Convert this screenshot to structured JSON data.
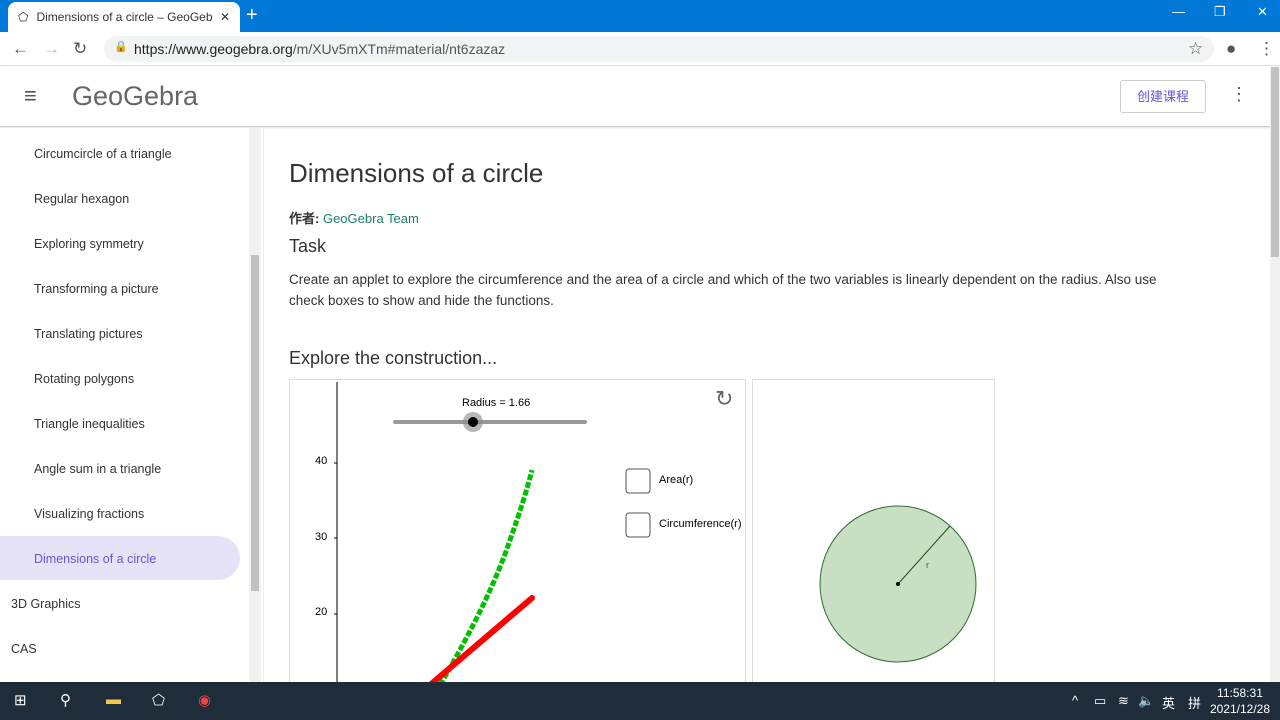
{
  "browser": {
    "tab_title": "Dimensions of a circle – GeoGebra",
    "url_domain": "https://www.geogebra.org",
    "url_path": "/m/XUv5mXTm#material/nt6zazaz"
  },
  "header": {
    "logo": "GeoGebra",
    "create_button": "创建课程"
  },
  "sidebar": {
    "items": [
      "Circumcircle of a triangle",
      "Regular hexagon",
      "Exploring symmetry",
      "Transforming a picture",
      "Translating pictures",
      "Rotating polygons",
      "Triangle inequalities",
      "Angle sum in a triangle",
      "Visualizing fractions",
      "Dimensions of a circle"
    ],
    "sections": [
      "3D Graphics",
      "CAS"
    ]
  },
  "main": {
    "title": "Dimensions of a circle",
    "author_label": "作者:",
    "author": "GeoGebra Team",
    "task_heading": "Task",
    "task_text": "Create an applet to explore the circumference and the area of a circle and which of the two variables is linearly dependent on the radius. Also use check boxes to show and hide the functions.",
    "explore_heading": "Explore the construction..."
  },
  "applet": {
    "slider_label": "Radius = 1.66",
    "radius": 1.66,
    "slider_min": 0,
    "slider_max": 3.5,
    "y_ticks": [
      "40",
      "30",
      "20"
    ],
    "checkbox_area": "Area(r)",
    "checkbox_circ": "Circumference(r)",
    "circle_label": "r",
    "colors": {
      "area": "#00c000",
      "circumference": "#ff0000",
      "circle_fill": "#c8dfc4"
    }
  },
  "taskbar": {
    "time": "11:58:31",
    "date": "2021/12/28",
    "ime1": "英",
    "ime2": "拼"
  }
}
